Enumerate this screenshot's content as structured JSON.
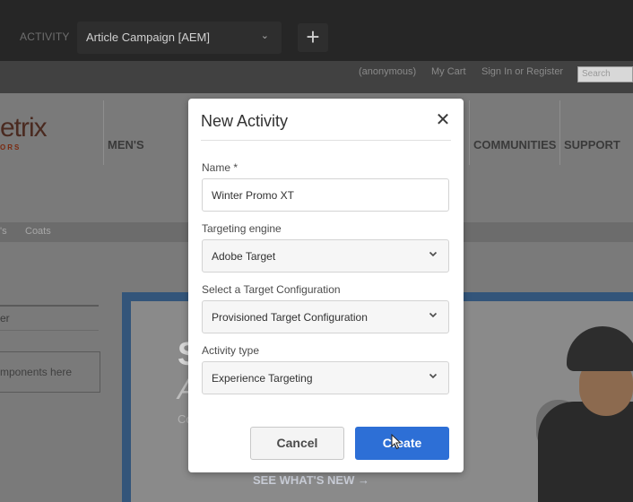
{
  "topbar": {
    "activity_label": "ACTIVITY",
    "campaign_select": "Article Campaign [AEM]",
    "add_symbol": "+"
  },
  "sitebar": {
    "links": [
      "(anonymous)",
      "My Cart",
      "Sign In or Register"
    ],
    "search_placeholder": "Search"
  },
  "site": {
    "logo_text": "etrix",
    "logo_sub": "ORS",
    "nav": [
      "MEN'S",
      "COMMUNITIES",
      "SUPPORT"
    ],
    "breadcrumbs": [
      "'s",
      "Coats"
    ],
    "left_panel_text": "er",
    "drop_hint": "mponents here",
    "hero_big": "S",
    "hero_big2": "A",
    "hero_small": "Co",
    "hero_cta": "SEE WHAT'S NEW →"
  },
  "modal": {
    "title": "New Activity",
    "close_symbol": "✕",
    "name_label": "Name *",
    "name_value": "Winter Promo XT",
    "targeting_label": "Targeting engine",
    "targeting_value": "Adobe Target",
    "config_label": "Select a Target Configuration",
    "config_value": "Provisioned Target Configuration",
    "type_label": "Activity type",
    "type_value": "Experience Targeting",
    "cancel_label": "Cancel",
    "create_label": "Create"
  },
  "colors": {
    "primary": "#2d6fd6",
    "topbar": "#262626"
  }
}
